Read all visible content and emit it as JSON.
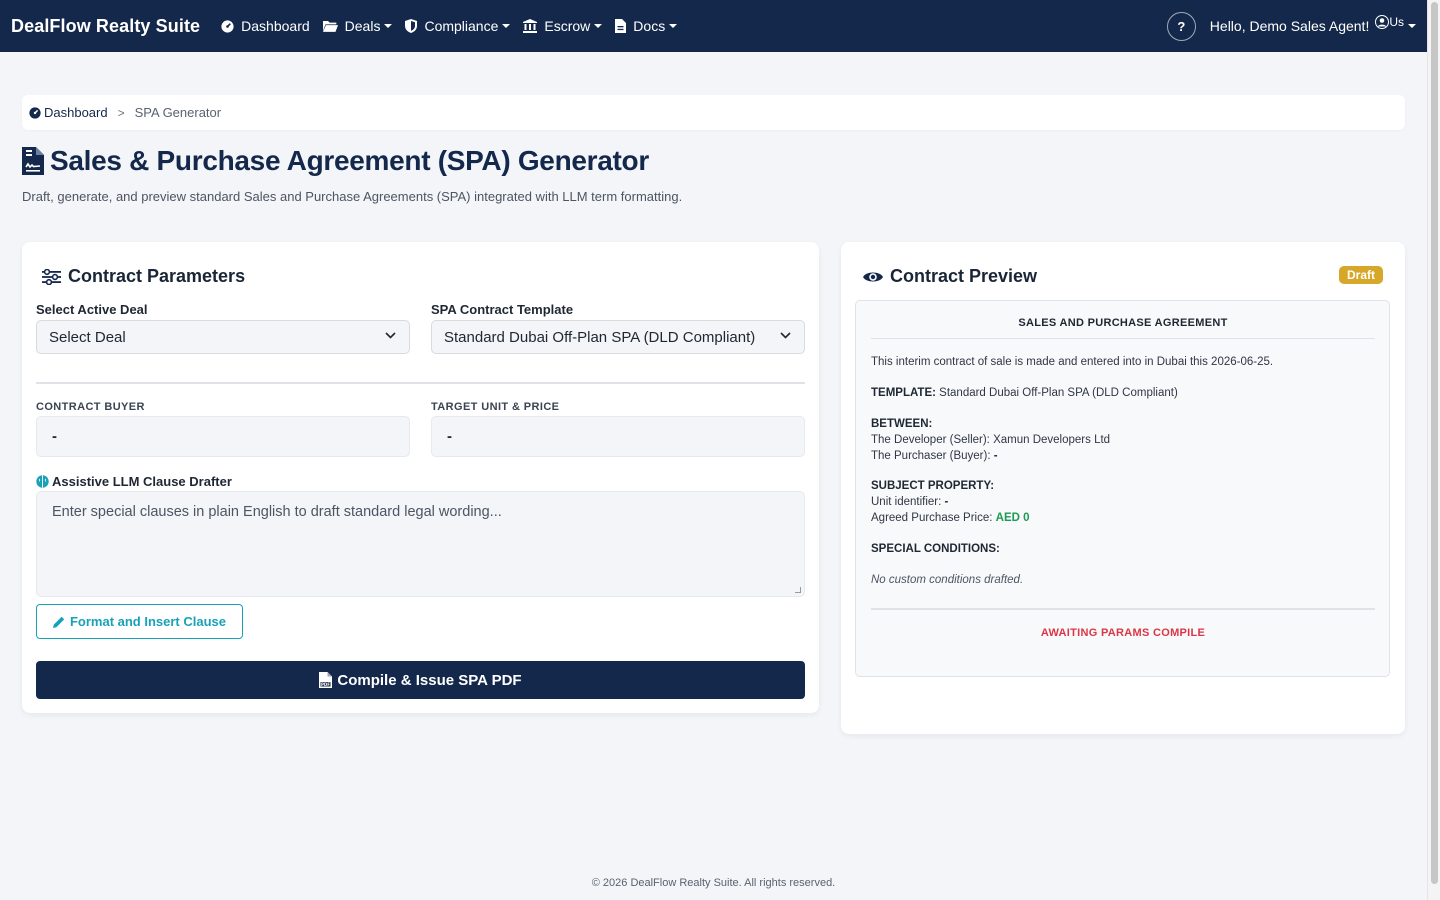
{
  "navbar": {
    "brand": "DealFlow Realty Suite",
    "items": [
      {
        "label": "Dashboard",
        "icon": "dashboard-icon",
        "dropdown": false
      },
      {
        "label": "Deals",
        "icon": "folder-icon",
        "dropdown": true
      },
      {
        "label": "Compliance",
        "icon": "shield-icon",
        "dropdown": true
      },
      {
        "label": "Escrow",
        "icon": "bank-icon",
        "dropdown": true
      },
      {
        "label": "Docs",
        "icon": "document-icon",
        "dropdown": true
      }
    ],
    "help_label": "?",
    "greeting": "Hello, Demo Sales Agent!",
    "avatar_alt": "Us"
  },
  "breadcrumb": {
    "home": "Dashboard",
    "separator": ">",
    "current": "SPA Generator"
  },
  "page": {
    "title": "Sales & Purchase Agreement (SPA) Generator",
    "subtitle": "Draft, generate, and preview standard Sales and Purchase Agreements (SPA) integrated with LLM term formatting."
  },
  "params": {
    "title": "Contract Parameters",
    "deal_label": "Select Active Deal",
    "deal_value": "Select Deal",
    "template_label": "SPA Contract Template",
    "template_value": "Standard Dubai Off-Plan SPA (DLD Compliant)",
    "buyer_label": "CONTRACT BUYER",
    "buyer_value": "-",
    "unit_label": "TARGET UNIT & PRICE",
    "unit_value": "-",
    "llm_label": "Assistive LLM Clause Drafter",
    "llm_placeholder": "Enter special clauses in plain English to draft standard legal wording...",
    "format_button": "Format and Insert Clause",
    "compile_button": "Compile & Issue SPA PDF"
  },
  "preview": {
    "title": "Contract Preview",
    "badge": "Draft",
    "heading": "SALES AND PURCHASE AGREEMENT",
    "intro": "This interim contract of sale is made and entered into in Dubai this 2026-06-25.",
    "template_key": "TEMPLATE:",
    "template_value": "Standard Dubai Off-Plan SPA (DLD Compliant)",
    "between_key": "BETWEEN:",
    "developer_line": "The Developer (Seller): Xamun Developers Ltd",
    "purchaser_prefix": "The Purchaser (Buyer):",
    "purchaser_value": "-",
    "property_key": "SUBJECT PROPERTY:",
    "unit_prefix": "Unit identifier:",
    "unit_value": "-",
    "price_prefix": "Agreed Purchase Price:",
    "price_value": "AED 0",
    "conditions_key": "SPECIAL CONDITIONS:",
    "conditions_value": "No custom conditions drafted.",
    "status": "AWAITING PARAMS COMPILE"
  },
  "footer": "© 2026 DealFlow Realty Suite. All rights reserved.",
  "colors": {
    "navbar": "#14284b",
    "primary": "#14284b",
    "info": "#17a2b8",
    "badge": "#d7a72a",
    "success": "#1e9a55",
    "danger": "#dc3545",
    "background": "#f3f5f8"
  }
}
